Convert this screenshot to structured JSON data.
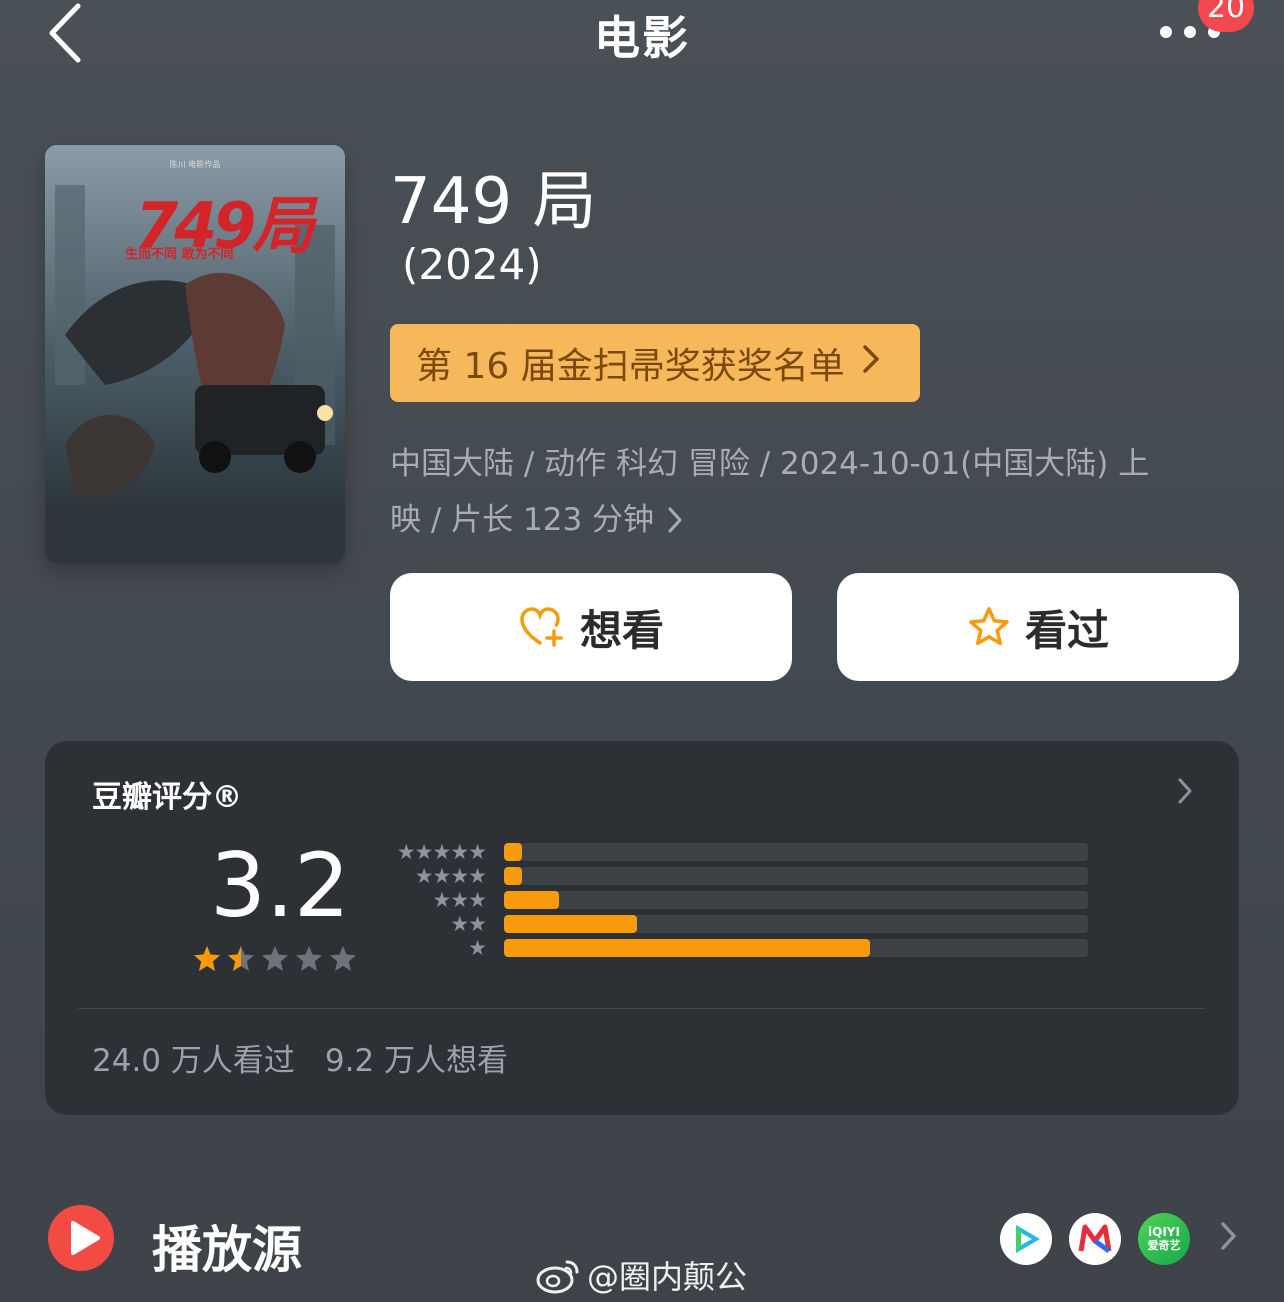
{
  "header": {
    "back_icon": "chevron-left-icon",
    "title": "电影",
    "more_icon": "more-dots-icon",
    "badge": "20"
  },
  "poster": {
    "studio": "陈川 电影作品",
    "title": "749局",
    "tagline": "生而不同 敢为不同"
  },
  "movie": {
    "name": "749 局",
    "year": "(2024)",
    "award_label": "第 16 届金扫帚奖获奖名单",
    "meta_line1": "中国大陆 / 动作 科幻 冒险 / 2024-10-01(中国大陆) 上",
    "meta_line2": "映 / 片长 123 分钟"
  },
  "actions": {
    "want_label": "想看",
    "seen_label": "看过"
  },
  "rating": {
    "title": "豆瓣评分®",
    "score": "3.2",
    "score_stars": 1.5,
    "max_stars": 5,
    "distribution": [
      {
        "stars": 5,
        "fraction": 0.03
      },
      {
        "stars": 4,
        "fraction": 0.03
      },
      {
        "stars": 3,
        "fraction": 0.095
      },
      {
        "stars": 2,
        "fraction": 0.227
      },
      {
        "stars": 1,
        "fraction": 0.627
      }
    ],
    "seen_count": "24.0 万人看过",
    "want_count": "9.2 万人想看"
  },
  "play_source": {
    "label": "播放源",
    "platforms": [
      "tencent-video-icon",
      "mgtv-icon",
      "iqiyi-icon"
    ],
    "iqiyi_text": "iQIYI",
    "iqiyi_sub": "爱奇艺"
  },
  "watermark": "@圈内颠公",
  "colors": {
    "accent": "#f79a0c",
    "award_bg": "#f7b85b",
    "badge": "#f2484f",
    "play_red": "#f24b43"
  }
}
